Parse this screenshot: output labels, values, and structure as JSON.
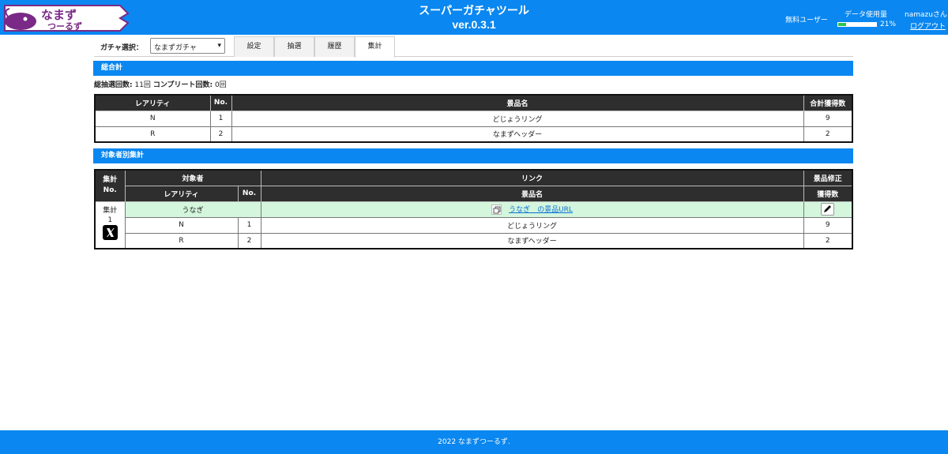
{
  "header": {
    "logo_text": "なまずつーるず",
    "title": "スーパーガチャツール",
    "version": "ver.0.3.1",
    "plan": "無料ユーザー",
    "usage_label": "データ使用量",
    "usage_percent": "21%",
    "usage_fraction": 0.21,
    "username": "namazuさん",
    "logout": "ログアウト"
  },
  "toolbar": {
    "gacha_label": "ガチャ選択：",
    "gacha_selected": "なまずガチャ",
    "tabs": [
      {
        "label": "設定"
      },
      {
        "label": "抽選"
      },
      {
        "label": "履歴"
      },
      {
        "label": "集計"
      }
    ],
    "active_tab": "集計"
  },
  "summary": {
    "section_title": "総合計",
    "total_draws_label": "総抽選回数:",
    "total_draws": "11回",
    "complete_label": "コンプリート回数:",
    "complete_count": "0回",
    "headers": [
      "レアリティ",
      "No.",
      "景品名",
      "合計獲得数"
    ],
    "rows": [
      {
        "rarity": "N",
        "no": "1",
        "name": "どじょうリング",
        "count": "9"
      },
      {
        "rarity": "R",
        "no": "2",
        "name": "なまずヘッダー",
        "count": "2"
      }
    ]
  },
  "by_target": {
    "section_title": "対象者別集計",
    "h_agg_no_1": "集計",
    "h_agg_no_2": "No.",
    "h_target": "対象者",
    "h_link": "リンク",
    "h_edit": "景品修正",
    "h_rarity": "レアリティ",
    "h_no": "No.",
    "h_name": "景品名",
    "h_count": "獲得数",
    "agg_label": "集計",
    "agg_no": "1",
    "target_name": "うなぎ",
    "link_text": "うなぎ　の景品URL",
    "rows": [
      {
        "rarity": "N",
        "no": "1",
        "name": "どじょうリング",
        "count": "9"
      },
      {
        "rarity": "R",
        "no": "2",
        "name": "なまずヘッダー",
        "count": "2"
      }
    ]
  },
  "footer": {
    "text": "2022 なまずつーるず."
  },
  "colors": {
    "primary": "#0a87f0",
    "header_dark": "#2e2e2e",
    "highlight_row": "#d4f6dc",
    "usage_fill": "#2ec44e",
    "logo_purple": "#7a2a86"
  }
}
